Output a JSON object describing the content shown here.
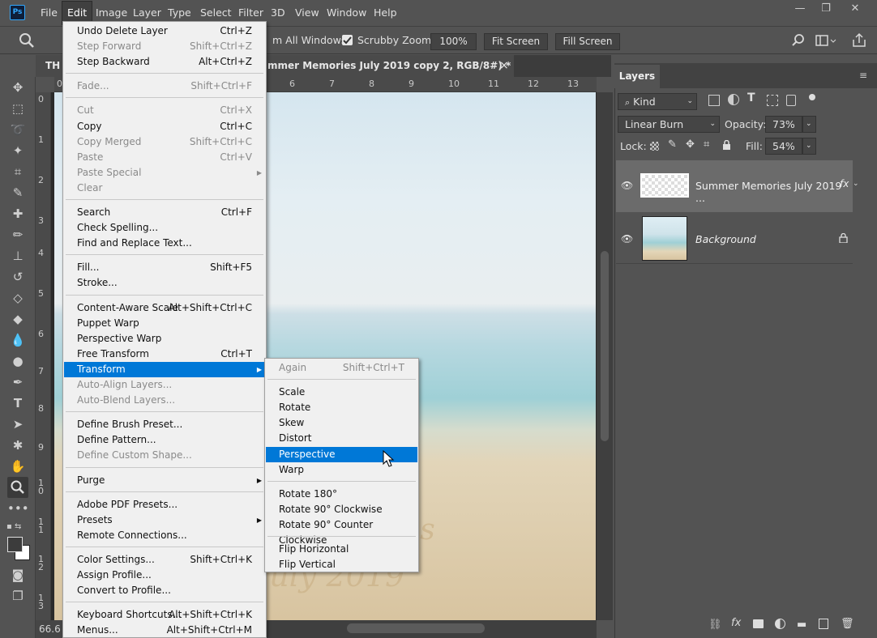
{
  "menubar": {
    "logo": "Ps",
    "items": [
      "File",
      "Edit",
      "Image",
      "Layer",
      "Type",
      "Select",
      "Filter",
      "3D",
      "View",
      "Window",
      "Help"
    ],
    "active": "Edit",
    "window_controls": {
      "minimize": "—",
      "restore": "❐",
      "close": "✕"
    }
  },
  "options": {
    "all_windows_label": "m All Windows",
    "scrubby_zoom_label": "Scrubby Zoom",
    "scrubby_checked": true,
    "zoom_value": "100%",
    "fit_screen": "Fit Screen",
    "fill_screen": "Fill Screen"
  },
  "document": {
    "tab_prefix": "TH",
    "tab_title": "mmer Memories July 2019 copy 2, RGB/8#) *",
    "close": "×",
    "zoom_status": "66.6",
    "canvas_text": "July 2019",
    "canvas_text2": "es"
  },
  "ruler": {
    "top": [
      "0",
      "6",
      "7",
      "8",
      "9",
      "10",
      "11",
      "12",
      "13"
    ],
    "left": [
      "0",
      "1",
      "2",
      "3",
      "4",
      "5",
      "6",
      "7",
      "8",
      "9",
      "1\n0",
      "1\n1",
      "1\n2",
      "1\n3"
    ]
  },
  "edit_menu": {
    "groups": [
      [
        {
          "label": "Undo Delete Layer",
          "shortcut": "Ctrl+Z"
        },
        {
          "label": "Step Forward",
          "shortcut": "Shift+Ctrl+Z",
          "disabled": true
        },
        {
          "label": "Step Backward",
          "shortcut": "Alt+Ctrl+Z"
        }
      ],
      [
        {
          "label": "Fade...",
          "shortcut": "Shift+Ctrl+F",
          "disabled": true
        }
      ],
      [
        {
          "label": "Cut",
          "shortcut": "Ctrl+X",
          "disabled": true
        },
        {
          "label": "Copy",
          "shortcut": "Ctrl+C"
        },
        {
          "label": "Copy Merged",
          "shortcut": "Shift+Ctrl+C",
          "disabled": true
        },
        {
          "label": "Paste",
          "shortcut": "Ctrl+V",
          "disabled": true
        },
        {
          "label": "Paste Special",
          "shortcut": "",
          "disabled": true,
          "submenu": true
        },
        {
          "label": "Clear",
          "shortcut": "",
          "disabled": true
        }
      ],
      [
        {
          "label": "Search",
          "shortcut": "Ctrl+F"
        },
        {
          "label": "Check Spelling...",
          "shortcut": ""
        },
        {
          "label": "Find and Replace Text...",
          "shortcut": ""
        }
      ],
      [
        {
          "label": "Fill...",
          "shortcut": "Shift+F5"
        },
        {
          "label": "Stroke...",
          "shortcut": ""
        }
      ],
      [
        {
          "label": "Content-Aware Scale",
          "shortcut": "Alt+Shift+Ctrl+C"
        },
        {
          "label": "Puppet Warp",
          "shortcut": ""
        },
        {
          "label": "Perspective Warp",
          "shortcut": ""
        },
        {
          "label": "Free Transform",
          "shortcut": "Ctrl+T"
        },
        {
          "label": "Transform",
          "shortcut": "",
          "submenu": true,
          "highlighted": true
        },
        {
          "label": "Auto-Align Layers...",
          "shortcut": "",
          "disabled": true
        },
        {
          "label": "Auto-Blend Layers...",
          "shortcut": "",
          "disabled": true
        }
      ],
      [
        {
          "label": "Define Brush Preset...",
          "shortcut": ""
        },
        {
          "label": "Define Pattern...",
          "shortcut": ""
        },
        {
          "label": "Define Custom Shape...",
          "shortcut": "",
          "disabled": true
        }
      ],
      [
        {
          "label": "Purge",
          "shortcut": "",
          "submenu": true
        }
      ],
      [
        {
          "label": "Adobe PDF Presets...",
          "shortcut": ""
        },
        {
          "label": "Presets",
          "shortcut": "",
          "submenu": true
        },
        {
          "label": "Remote Connections...",
          "shortcut": ""
        }
      ],
      [
        {
          "label": "Color Settings...",
          "shortcut": "Shift+Ctrl+K"
        },
        {
          "label": "Assign Profile...",
          "shortcut": ""
        },
        {
          "label": "Convert to Profile...",
          "shortcut": ""
        }
      ],
      [
        {
          "label": "Keyboard Shortcuts...",
          "shortcut": "Alt+Shift+Ctrl+K"
        },
        {
          "label": "Menus...",
          "shortcut": "Alt+Shift+Ctrl+M"
        }
      ]
    ]
  },
  "transform_menu": {
    "groups": [
      [
        {
          "label": "Again",
          "shortcut": "Shift+Ctrl+T",
          "disabled": true
        }
      ],
      [
        {
          "label": "Scale"
        },
        {
          "label": "Rotate"
        },
        {
          "label": "Skew"
        },
        {
          "label": "Distort"
        },
        {
          "label": "Perspective",
          "highlighted": true
        },
        {
          "label": "Warp"
        }
      ],
      [
        {
          "label": "Rotate 180°"
        },
        {
          "label": "Rotate 90° Clockwise"
        },
        {
          "label": "Rotate 90° Counter Clockwise"
        }
      ],
      [
        {
          "label": "Flip Horizontal"
        },
        {
          "label": "Flip Vertical"
        }
      ]
    ]
  },
  "layers_panel": {
    "tab": "Layers",
    "filter_kind": "Kind",
    "blend_mode": "Linear Burn",
    "opacity_label": "Opacity:",
    "opacity_value": "73%",
    "lock_label": "Lock:",
    "fill_label": "Fill:",
    "fill_value": "54%",
    "layers": [
      {
        "name": "Summer Memories July 2019 ...",
        "fx": "fx",
        "selected": true
      },
      {
        "name": "Background",
        "locked": true
      }
    ]
  }
}
